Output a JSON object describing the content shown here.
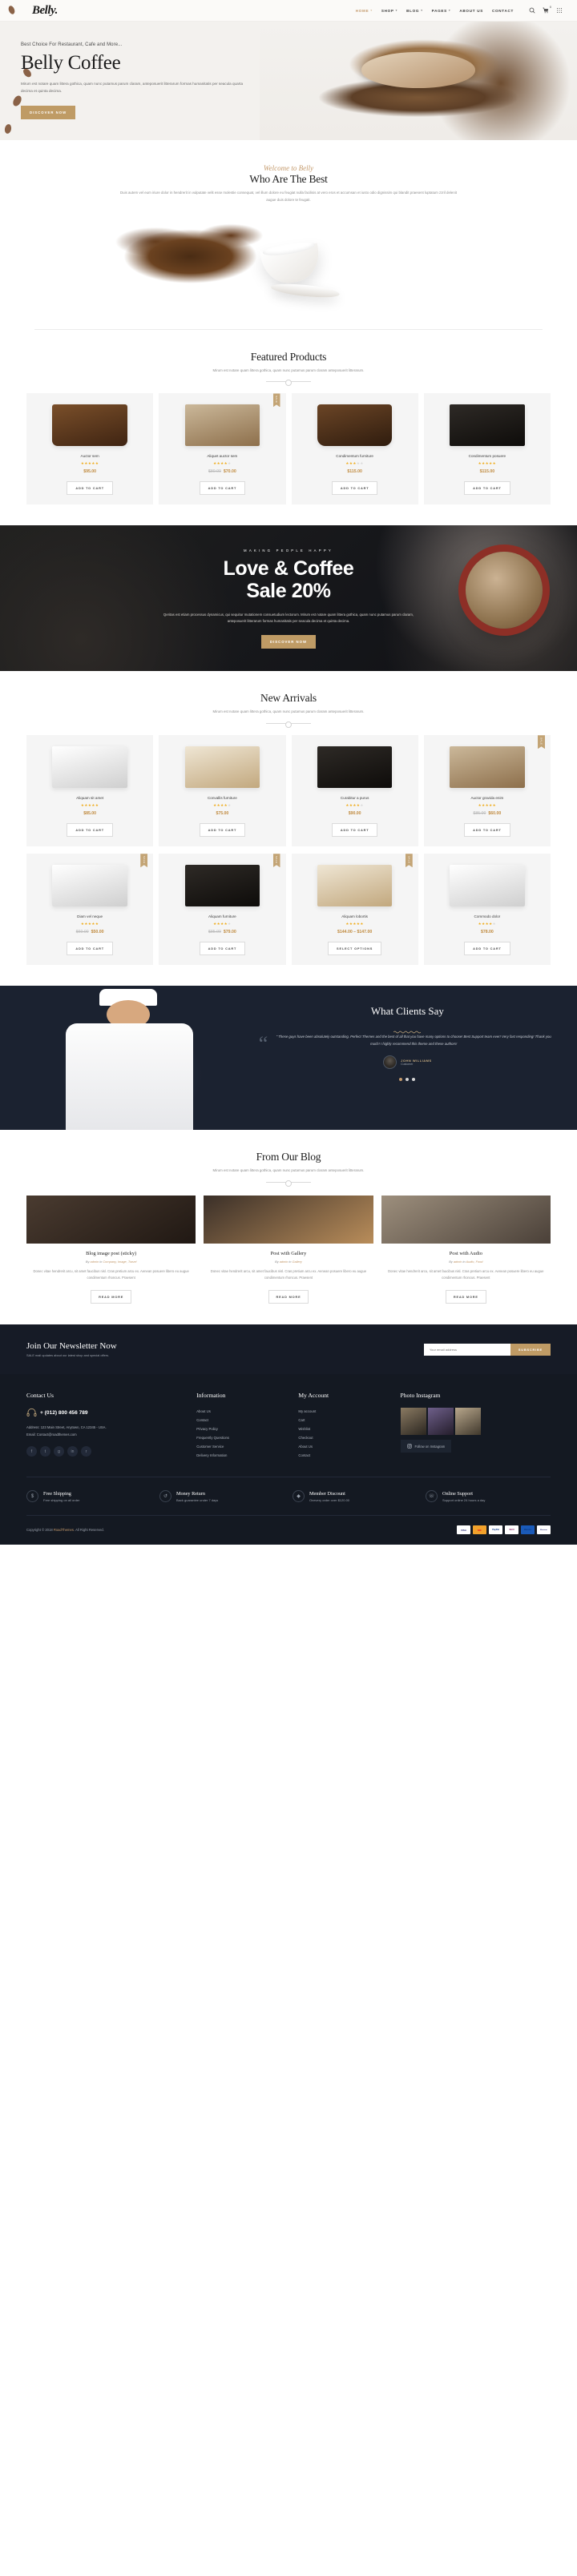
{
  "header": {
    "logo": "Belly.",
    "nav": [
      {
        "label": "HOME",
        "caret": true,
        "active": true
      },
      {
        "label": "SHOP",
        "caret": true,
        "active": false
      },
      {
        "label": "BLOG",
        "caret": true,
        "active": false
      },
      {
        "label": "PAGES",
        "caret": true,
        "active": false
      },
      {
        "label": "ABOUT US",
        "caret": false,
        "active": false
      },
      {
        "label": "CONTACT",
        "caret": false,
        "active": false
      }
    ],
    "cart_count": "0"
  },
  "hero": {
    "subtitle": "Best Choice For Restaurant, Cafe and More...",
    "title": "Belly Coffee",
    "description": "Mirum est notare quam littera gothica, quam nunc putamus parum claram, anteposuerit litterarum formas humanitatis per seacula quarta decima et quinta decima.",
    "button": "DISCOVER NOW"
  },
  "about": {
    "script": "Welcome to Belly",
    "title": "Who Are The Best",
    "description": "Duis autem vel eum iriure dolor in hendrerit in vulputate velit esse molestie consequat, vel illum dolore eu feugiat nulla facilisis at vero eros et accumsan et iusto odio dignissim qui blandit praesent luptatum zzril delenit augue duis dolore te feugait."
  },
  "featured": {
    "title": "Featured Products",
    "description": "Mirum est notare quam littera gothica, quam nunc putamus parum claram anteposuerit litterarum.",
    "products": [
      {
        "name": "Auctor sem",
        "stars": 5,
        "price": "$95.00",
        "old_price": "",
        "button": "ADD TO CART",
        "badge": ""
      },
      {
        "name": "Aliquet auctor sem",
        "stars": 4,
        "price": "$70.00",
        "old_price": "$80.00",
        "button": "ADD TO CART",
        "badge": "SALE"
      },
      {
        "name": "Condimentum furniture",
        "stars": 3,
        "price": "$115.00",
        "old_price": "",
        "button": "ADD TO CART",
        "badge": ""
      },
      {
        "name": "Condimentum posuere",
        "stars": 5,
        "price": "$115.00",
        "old_price": "",
        "button": "ADD TO CART",
        "badge": ""
      }
    ]
  },
  "promo": {
    "kicker": "MAKING PEOPLE HAPPY",
    "title_line1": "Love & Coffee",
    "title_line2": "Sale 20%",
    "description": "Qeritas est etiam processus dynamicus, qui sequitur mutationem consuetudium lectorum. Mirum est notare quam littera gothica, quam nunc putamus parum claram, anteposuerit litterarum formas humanitatis per seacula decima et quinta decima.",
    "button": "DISCOVER NOW"
  },
  "arrivals": {
    "title": "New Arrivals",
    "description": "Mirum est notare quam littera gothica, quam nunc putamus parum claram anteposuerit litterarum.",
    "products": [
      {
        "name": "Aliquam sit amet",
        "stars": 5,
        "price": "$85.00",
        "old_price": "",
        "button": "ADD TO CART",
        "badge": ""
      },
      {
        "name": "Convallis furniture",
        "stars": 4,
        "price": "$75.00",
        "old_price": "",
        "button": "ADD TO CART",
        "badge": ""
      },
      {
        "name": "Curabitur a purus",
        "stars": 4,
        "price": "$90.00",
        "old_price": "",
        "button": "ADD TO CART",
        "badge": ""
      },
      {
        "name": "Auctor gravida enim",
        "stars": 5,
        "price": "$60.00",
        "old_price": "$85.00",
        "button": "ADD TO CART",
        "badge": "SALE"
      },
      {
        "name": "Diam vel neque",
        "stars": 5,
        "price": "$50.00",
        "old_price": "$60.00",
        "button": "ADD TO CART",
        "badge": "SALE"
      },
      {
        "name": "Aliquam furniture",
        "stars": 4,
        "price": "$79.00",
        "old_price": "$85.00",
        "button": "ADD TO CART",
        "badge": "SALE"
      },
      {
        "name": "Aliquam lobortis",
        "stars": 5,
        "price": "$144.00 – $147.00",
        "old_price": "",
        "button": "SELECT OPTIONS",
        "badge": "SALE"
      },
      {
        "name": "Commodo dolor",
        "stars": 4,
        "price": "$78.00",
        "old_price": "",
        "button": "ADD TO CART",
        "badge": ""
      }
    ]
  },
  "testimonial": {
    "title": "What Clients Say",
    "quote": "\" These guys have been absolutely outstanding. Perfect Themes and the best of all that you have many options to choose! Best Support team ever! Very fast responding! Thank you much! I highly recommend this theme and these authors!",
    "person_name": "JOHN WILLIAMS",
    "person_role": "Customer"
  },
  "blog": {
    "title": "From Our Blog",
    "description": "Mirum est notare quam littera gothica, quam nunc putamus parum claram anteposuerit litterarum.",
    "posts": [
      {
        "title": "Blog image post (sticky)",
        "meta_by": "By ",
        "meta_author": "admin",
        "meta_in": " in ",
        "meta_cats": "Company, Image, Travel",
        "excerpt": "Donec vitae hendrerit arcu, sit amet faucibus nisl. Cras pretium arcu ex. Aenean posuere libero eu augue condimentum rhoncus. Praesent",
        "button": "READ MORE"
      },
      {
        "title": "Post with Gallery",
        "meta_by": "By ",
        "meta_author": "admin",
        "meta_in": " in ",
        "meta_cats": "Gallery",
        "excerpt": "Donec vitae hendrerit arcu, sit amet faucibus nisl. Cras pretium arcu ex. Aenean posuere libero eu augue condimentum rhoncus. Praesent",
        "button": "READ MORE"
      },
      {
        "title": "Post with Audio",
        "meta_by": "By ",
        "meta_author": "admin",
        "meta_in": " in ",
        "meta_cats": "Audio, Food",
        "excerpt": "Donec vitae hendrerit arcu, sit amet faucibus nisl. Cras pretium arcu ex. Aenean posuere libero eu augue condimentum rhoncus. Praesent",
        "button": "READ MORE"
      }
    ]
  },
  "newsletter": {
    "title": "Join Our Newsletter Now",
    "subtitle": "SALE mail updates about our latest shop and special offers.",
    "placeholder": "Your email address",
    "button": "SUBSCRIBE"
  },
  "footer": {
    "contact": {
      "heading": "Contact Us",
      "phone": "+ (012) 800 456 789",
      "address": "Address: 123 Main Street, Anytown, CA 12345 - USA.",
      "email": "Email: Contact@roadthemes.com",
      "socials": [
        "f",
        "t",
        "g",
        "in",
        "r"
      ]
    },
    "information": {
      "heading": "Information",
      "links": [
        "About Us",
        "Contact",
        "Privacy Policy",
        "Frequently Questions",
        "Customer Service",
        "Delivery Information"
      ]
    },
    "account": {
      "heading": "My Account",
      "links": [
        "My account",
        "Cart",
        "Wishlist",
        "Checkout",
        "About Us",
        "Contact"
      ]
    },
    "instagram": {
      "heading": "Photo Instagram",
      "follow": "Follow on Instagram"
    },
    "features": [
      {
        "icon": "$",
        "title": "Free Shipping",
        "subtitle": "Free shipping on all order"
      },
      {
        "icon": "↺",
        "title": "Money Return",
        "subtitle": "Back guarantee under 7 days"
      },
      {
        "icon": "◆",
        "title": "Member Discount",
        "subtitle": "Onevery order over $120.00"
      },
      {
        "icon": "☏",
        "title": "Online Support",
        "subtitle": "Support online 24 hours a day"
      }
    ],
    "copyright_pre": "Copyright © 2018 ",
    "copyright_brand": "RoadThemes",
    "copyright_post": ". All Right Reserved.",
    "payments": [
      "VISA",
      "MC",
      "PayPal",
      "Skrill",
      "Maestro",
      "Electron"
    ]
  },
  "colors": {
    "gold": "#bf9b65",
    "dark": "#141922",
    "star": "#f0ac1b",
    "price": "#c08a3e"
  }
}
